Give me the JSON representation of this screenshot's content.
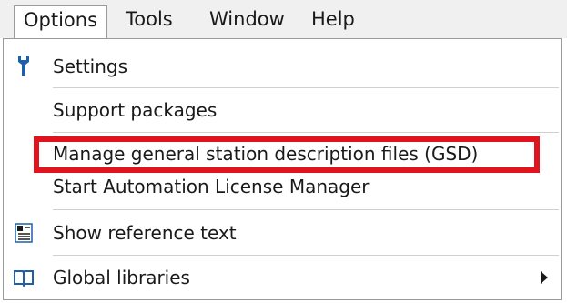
{
  "menubar": {
    "items": [
      {
        "label": "Options"
      },
      {
        "label": "Tools"
      },
      {
        "label": "Window"
      },
      {
        "label": "Help"
      }
    ]
  },
  "options_menu": {
    "items": [
      {
        "label": "Settings",
        "icon": "wrench-icon"
      },
      {
        "label": "Support packages"
      },
      {
        "label": "Manage general station description files (GSD)",
        "highlighted": true
      },
      {
        "label": "Start Automation License Manager"
      },
      {
        "label": "Show reference text",
        "icon": "reference-text-icon"
      },
      {
        "label": "Global libraries",
        "icon": "book-icon",
        "submenu": true
      }
    ]
  },
  "colors": {
    "highlight": "#e0141e",
    "icon_blue": "#1f5fa8"
  }
}
